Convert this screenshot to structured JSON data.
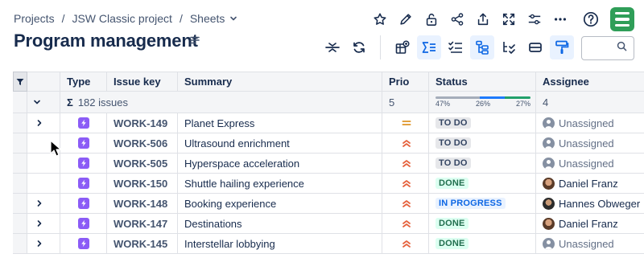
{
  "breadcrumb": {
    "items": [
      "Projects",
      "JSW Classic project",
      "Sheets"
    ],
    "separator": "/"
  },
  "title": "Program management",
  "toolbar_icons": [
    "star-icon",
    "pencil-icon",
    "lock-icon",
    "share-icon",
    "export-icon",
    "fullscreen-icon",
    "settings-sliders-icon",
    "more-icon",
    "help-icon",
    "app-logo"
  ],
  "view_icons": [
    "collapse-rows-icon",
    "refresh-icon",
    "add-view-icon",
    "sum-icon",
    "checklist-icon",
    "hierarchy-icon",
    "nested-list-icon",
    "row-height-icon",
    "paint-roller-icon"
  ],
  "search": {
    "placeholder": ""
  },
  "columns": [
    "Type",
    "Issue key",
    "Summary",
    "Prio",
    "Status",
    "Assignee"
  ],
  "group": {
    "sigma": "Σ",
    "summary": "182 issues",
    "prio_count": "5",
    "status_breakdown": [
      {
        "label": "47%",
        "value": 47,
        "color": "#a5adba"
      },
      {
        "label": "26%",
        "value": 26,
        "color": "#1d7afc"
      },
      {
        "label": "27%",
        "value": 27,
        "color": "#22a06b"
      }
    ],
    "assignee_count": "4"
  },
  "rows": [
    {
      "expandable": true,
      "key": "WORK-149",
      "summary": "Planet Express",
      "prio": "medium",
      "status": "TO DO",
      "status_type": "todo",
      "assignee": "Unassigned",
      "assignee_type": "unassigned"
    },
    {
      "expandable": false,
      "key": "WORK-506",
      "summary": "Ultrasound enrichment",
      "prio": "high",
      "status": "TO DO",
      "status_type": "todo",
      "assignee": "Unassigned",
      "assignee_type": "unassigned"
    },
    {
      "expandable": false,
      "key": "WORK-505",
      "summary": "Hyperspace acceleration",
      "prio": "high",
      "status": "TO DO",
      "status_type": "todo",
      "assignee": "Unassigned",
      "assignee_type": "unassigned"
    },
    {
      "expandable": false,
      "key": "WORK-150",
      "summary": "Shuttle hailing experience",
      "prio": "high",
      "status": "DONE",
      "status_type": "done",
      "assignee": "Daniel Franz",
      "assignee_type": "daniel"
    },
    {
      "expandable": true,
      "key": "WORK-148",
      "summary": "Booking experience",
      "prio": "high",
      "status": "IN PROGRESS",
      "status_type": "progress",
      "assignee": "Hannes Obweger",
      "assignee_type": "hannes"
    },
    {
      "expandable": true,
      "key": "WORK-147",
      "summary": "Destinations",
      "prio": "high",
      "status": "DONE",
      "status_type": "done",
      "assignee": "Daniel Franz",
      "assignee_type": "daniel"
    },
    {
      "expandable": true,
      "key": "WORK-145",
      "summary": "Interstellar lobbying",
      "prio": "high",
      "status": "DONE",
      "status_type": "done",
      "assignee": "Unassigned",
      "assignee_type": "unassigned"
    }
  ],
  "colors": {
    "type_icon": "#8b5cf6",
    "prio_medium": "#e2a03f",
    "prio_high": "#e5623d",
    "accent": "#0c66e4"
  }
}
